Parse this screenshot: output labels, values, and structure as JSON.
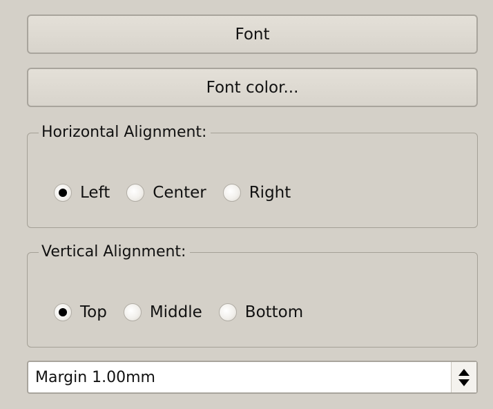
{
  "buttons": {
    "font_label": "Font",
    "font_color_label": "Font color..."
  },
  "horizontal_alignment": {
    "title": "Horizontal Alignment:",
    "options": [
      "Left",
      "Center",
      "Right"
    ],
    "selected": "Left"
  },
  "vertical_alignment": {
    "title": "Vertical Alignment:",
    "options": [
      "Top",
      "Middle",
      "Bottom"
    ],
    "selected": "Top"
  },
  "margin": {
    "value": "Margin 1.00mm"
  },
  "colors": {
    "background": "#d4d0c8",
    "radio_selected": "#000000"
  }
}
